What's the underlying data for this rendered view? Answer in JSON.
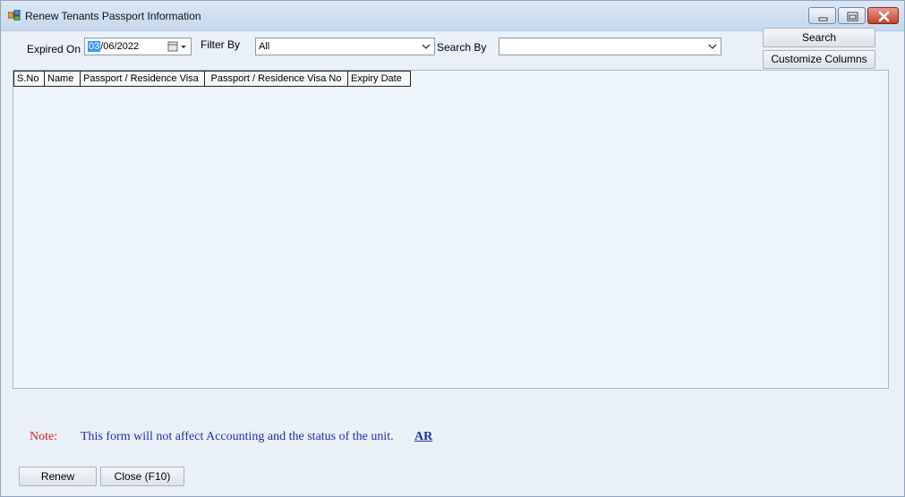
{
  "window": {
    "title": "Renew Tenants Passport Information"
  },
  "filters": {
    "expired_on_label": "Expired On",
    "date_day": "03",
    "date_rest": "/06/2022",
    "filter_by_label": "Filter By",
    "filter_by_value": "All",
    "search_by_label": "Search By",
    "search_by_value": ""
  },
  "buttons": {
    "search": "Search",
    "customize_columns": "Customize Columns",
    "renew": "Renew",
    "close": "Close (F10)"
  },
  "grid": {
    "columns": [
      "S.No",
      "Name",
      "Passport / Residence Visa",
      "Passport / Residence Visa No",
      "Expiry Date"
    ],
    "rows": []
  },
  "note": {
    "label": "Note:",
    "text": "This form will not affect Accounting and the status of the unit.",
    "link": "AR"
  },
  "colors": {
    "note_label": "#d42323",
    "note_text": "#1f2fa8",
    "selection": "#3399ff"
  }
}
